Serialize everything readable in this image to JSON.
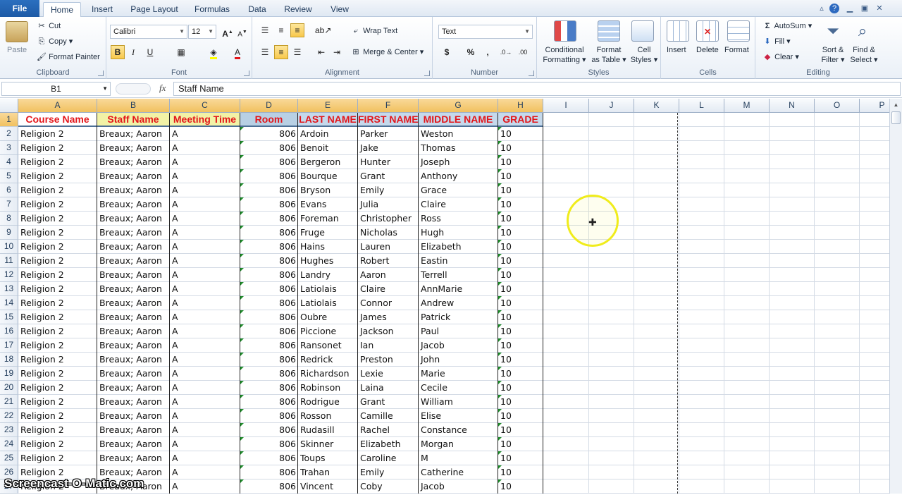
{
  "tabs": [
    "File",
    "Home",
    "Insert",
    "Page Layout",
    "Formulas",
    "Data",
    "Review",
    "View"
  ],
  "active_tab": "Home",
  "ribbon": {
    "clipboard": {
      "label": "Clipboard",
      "paste": "Paste",
      "cut": "Cut",
      "copy": "Copy",
      "format_painter": "Format Painter"
    },
    "font": {
      "label": "Font",
      "family": "Calibri",
      "size": "12"
    },
    "alignment": {
      "label": "Alignment",
      "wrap": "Wrap Text",
      "merge": "Merge & Center"
    },
    "number": {
      "label": "Number",
      "format": "Text",
      "currency": "$",
      "percent": "%",
      "comma": ","
    },
    "styles": {
      "label": "Styles",
      "conditional": "Conditional",
      "conditional2": "Formatting",
      "format_table": "Format",
      "format_table2": "as Table",
      "cell_styles": "Cell",
      "cell_styles2": "Styles"
    },
    "cells": {
      "label": "Cells",
      "insert": "Insert",
      "delete": "Delete",
      "format": "Format"
    },
    "editing": {
      "label": "Editing",
      "autosum": "AutoSum",
      "fill": "Fill",
      "clear": "Clear",
      "sort": "Sort &",
      "sort2": "Filter",
      "find": "Find &",
      "find2": "Select"
    }
  },
  "formula_bar": {
    "name_box": "B1",
    "fx": "fx",
    "value": "Staff Name"
  },
  "columns": [
    "A",
    "B",
    "C",
    "D",
    "E",
    "F",
    "G",
    "H",
    "I",
    "J",
    "K",
    "L",
    "M",
    "N",
    "O",
    "P"
  ],
  "header_row": [
    "Course Name",
    "Staff Name",
    "Meeting Time",
    "Room",
    "LAST NAME",
    "FIRST NAME",
    "MIDDLE NAME",
    "GRADE"
  ],
  "rows": [
    [
      "Religion 2",
      "Breaux; Aaron",
      "A",
      "806",
      "Ardoin",
      "Parker",
      "Weston",
      "10"
    ],
    [
      "Religion 2",
      "Breaux; Aaron",
      "A",
      "806",
      "Benoit",
      "Jake",
      "Thomas",
      "10"
    ],
    [
      "Religion 2",
      "Breaux; Aaron",
      "A",
      "806",
      "Bergeron",
      "Hunter",
      "Joseph",
      "10"
    ],
    [
      "Religion 2",
      "Breaux; Aaron",
      "A",
      "806",
      "Bourque",
      "Grant",
      "Anthony",
      "10"
    ],
    [
      "Religion 2",
      "Breaux; Aaron",
      "A",
      "806",
      "Bryson",
      "Emily",
      "Grace",
      "10"
    ],
    [
      "Religion 2",
      "Breaux; Aaron",
      "A",
      "806",
      "Evans",
      "Julia",
      "Claire",
      "10"
    ],
    [
      "Religion 2",
      "Breaux; Aaron",
      "A",
      "806",
      "Foreman",
      "Christopher",
      "Ross",
      "10"
    ],
    [
      "Religion 2",
      "Breaux; Aaron",
      "A",
      "806",
      "Fruge",
      "Nicholas",
      "Hugh",
      "10"
    ],
    [
      "Religion 2",
      "Breaux; Aaron",
      "A",
      "806",
      "Hains",
      "Lauren",
      "Elizabeth",
      "10"
    ],
    [
      "Religion 2",
      "Breaux; Aaron",
      "A",
      "806",
      "Hughes",
      "Robert",
      "Eastin",
      "10"
    ],
    [
      "Religion 2",
      "Breaux; Aaron",
      "A",
      "806",
      "Landry",
      "Aaron",
      "Terrell",
      "10"
    ],
    [
      "Religion 2",
      "Breaux; Aaron",
      "A",
      "806",
      "Latiolais",
      "Claire",
      "AnnMarie",
      "10"
    ],
    [
      "Religion 2",
      "Breaux; Aaron",
      "A",
      "806",
      "Latiolais",
      "Connor",
      "Andrew",
      "10"
    ],
    [
      "Religion 2",
      "Breaux; Aaron",
      "A",
      "806",
      "Oubre",
      "James",
      "Patrick",
      "10"
    ],
    [
      "Religion 2",
      "Breaux; Aaron",
      "A",
      "806",
      "Piccione",
      "Jackson",
      "Paul",
      "10"
    ],
    [
      "Religion 2",
      "Breaux; Aaron",
      "A",
      "806",
      "Ransonet",
      "Ian",
      "Jacob",
      "10"
    ],
    [
      "Religion 2",
      "Breaux; Aaron",
      "A",
      "806",
      "Redrick",
      "Preston",
      "John",
      "10"
    ],
    [
      "Religion 2",
      "Breaux; Aaron",
      "A",
      "806",
      "Richardson",
      "Lexie",
      "Marie",
      "10"
    ],
    [
      "Religion 2",
      "Breaux; Aaron",
      "A",
      "806",
      "Robinson",
      "Laina",
      "Cecile",
      "10"
    ],
    [
      "Religion 2",
      "Breaux; Aaron",
      "A",
      "806",
      "Rodrigue",
      "Grant",
      "William",
      "10"
    ],
    [
      "Religion 2",
      "Breaux; Aaron",
      "A",
      "806",
      "Rosson",
      "Camille",
      "Elise",
      "10"
    ],
    [
      "Religion 2",
      "Breaux; Aaron",
      "A",
      "806",
      "Rudasill",
      "Rachel",
      "Constance",
      "10"
    ],
    [
      "Religion 2",
      "Breaux; Aaron",
      "A",
      "806",
      "Skinner",
      "Elizabeth",
      "Morgan",
      "10"
    ],
    [
      "Religion 2",
      "Breaux; Aaron",
      "A",
      "806",
      "Toups",
      "Caroline",
      "M",
      "10"
    ],
    [
      "Religion 2",
      "Breaux; Aaron",
      "A",
      "806",
      "Trahan",
      "Emily",
      "Catherine",
      "10"
    ],
    [
      "Religion 2",
      "Breaux; Aaron",
      "A",
      "806",
      "Vincent",
      "Coby",
      "Jacob",
      "10"
    ]
  ],
  "watermark": "Screencast-O-Matic.com",
  "colors": {
    "header_text": "#e3151a",
    "header_fill_A": "#ffffff",
    "header_fill_B": "#f2f2a6",
    "header_fill_C": "#f2f2a6",
    "header_fill_D": "#b8d0e4",
    "header_fill_E": "#c5d9ec",
    "header_fill_F": "#c5d9ec",
    "header_fill_G": "#c5d9ec",
    "header_fill_H": "#c5d9ec"
  }
}
